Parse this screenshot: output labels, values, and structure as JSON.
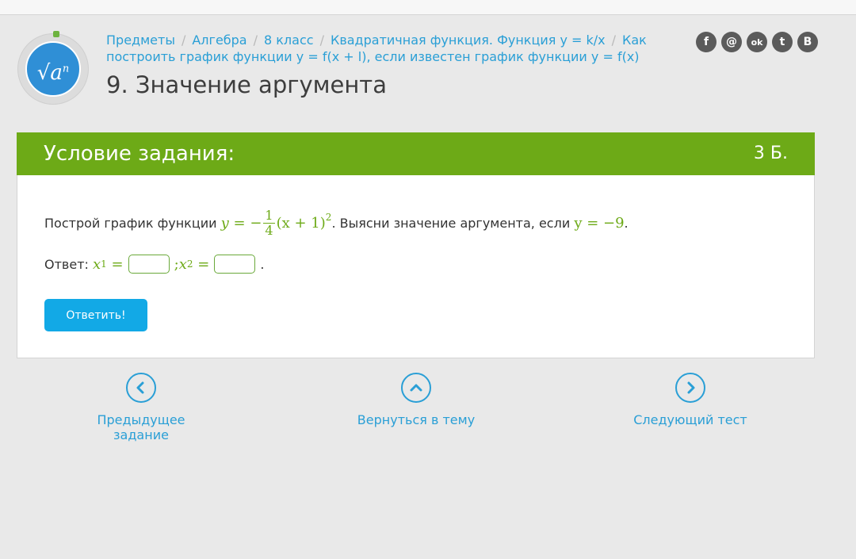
{
  "breadcrumb": [
    "Предметы",
    "Алгебра",
    "8 класс",
    "Квадратичная функция. Функция y = k/x",
    "Как построить график функции y = f(x + l), если известен график функции y = f(x)"
  ],
  "page_title": "9. Значение аргумента",
  "social_icons": [
    "facebook-icon",
    "mail-icon",
    "odnoklassniki-icon",
    "twitter-icon",
    "vk-icon"
  ],
  "social_glyphs": [
    "f",
    "@",
    "ok",
    "t",
    "B"
  ],
  "task": {
    "header": "Условие задания:",
    "points": "3 Б.",
    "text_before": "Построй график функции",
    "formula_lhs": "y",
    "formula_eq": "= −",
    "frac_num": "1",
    "frac_den": "4",
    "formula_rest": "(x + 1)",
    "formula_exp": "2",
    "text_after": ". Выясни значение аргумента, если",
    "condition": "y = −9",
    "period": "."
  },
  "answer": {
    "label": "Ответ:",
    "x1_label": "x",
    "x1_sub": "1",
    "x2_label": "x",
    "x2_sub": "2",
    "eq": "=",
    "semicolon": ";",
    "end": ".",
    "x1_value": "",
    "x2_value": ""
  },
  "submit_label": "Ответить!",
  "nav": {
    "prev": "Предыдущее задание",
    "back": "Вернуться в тему",
    "next": "Следующий тест"
  },
  "colors": {
    "accent_green": "#6daa17",
    "link_blue": "#2a9fd6",
    "button_blue": "#12a9e6"
  }
}
